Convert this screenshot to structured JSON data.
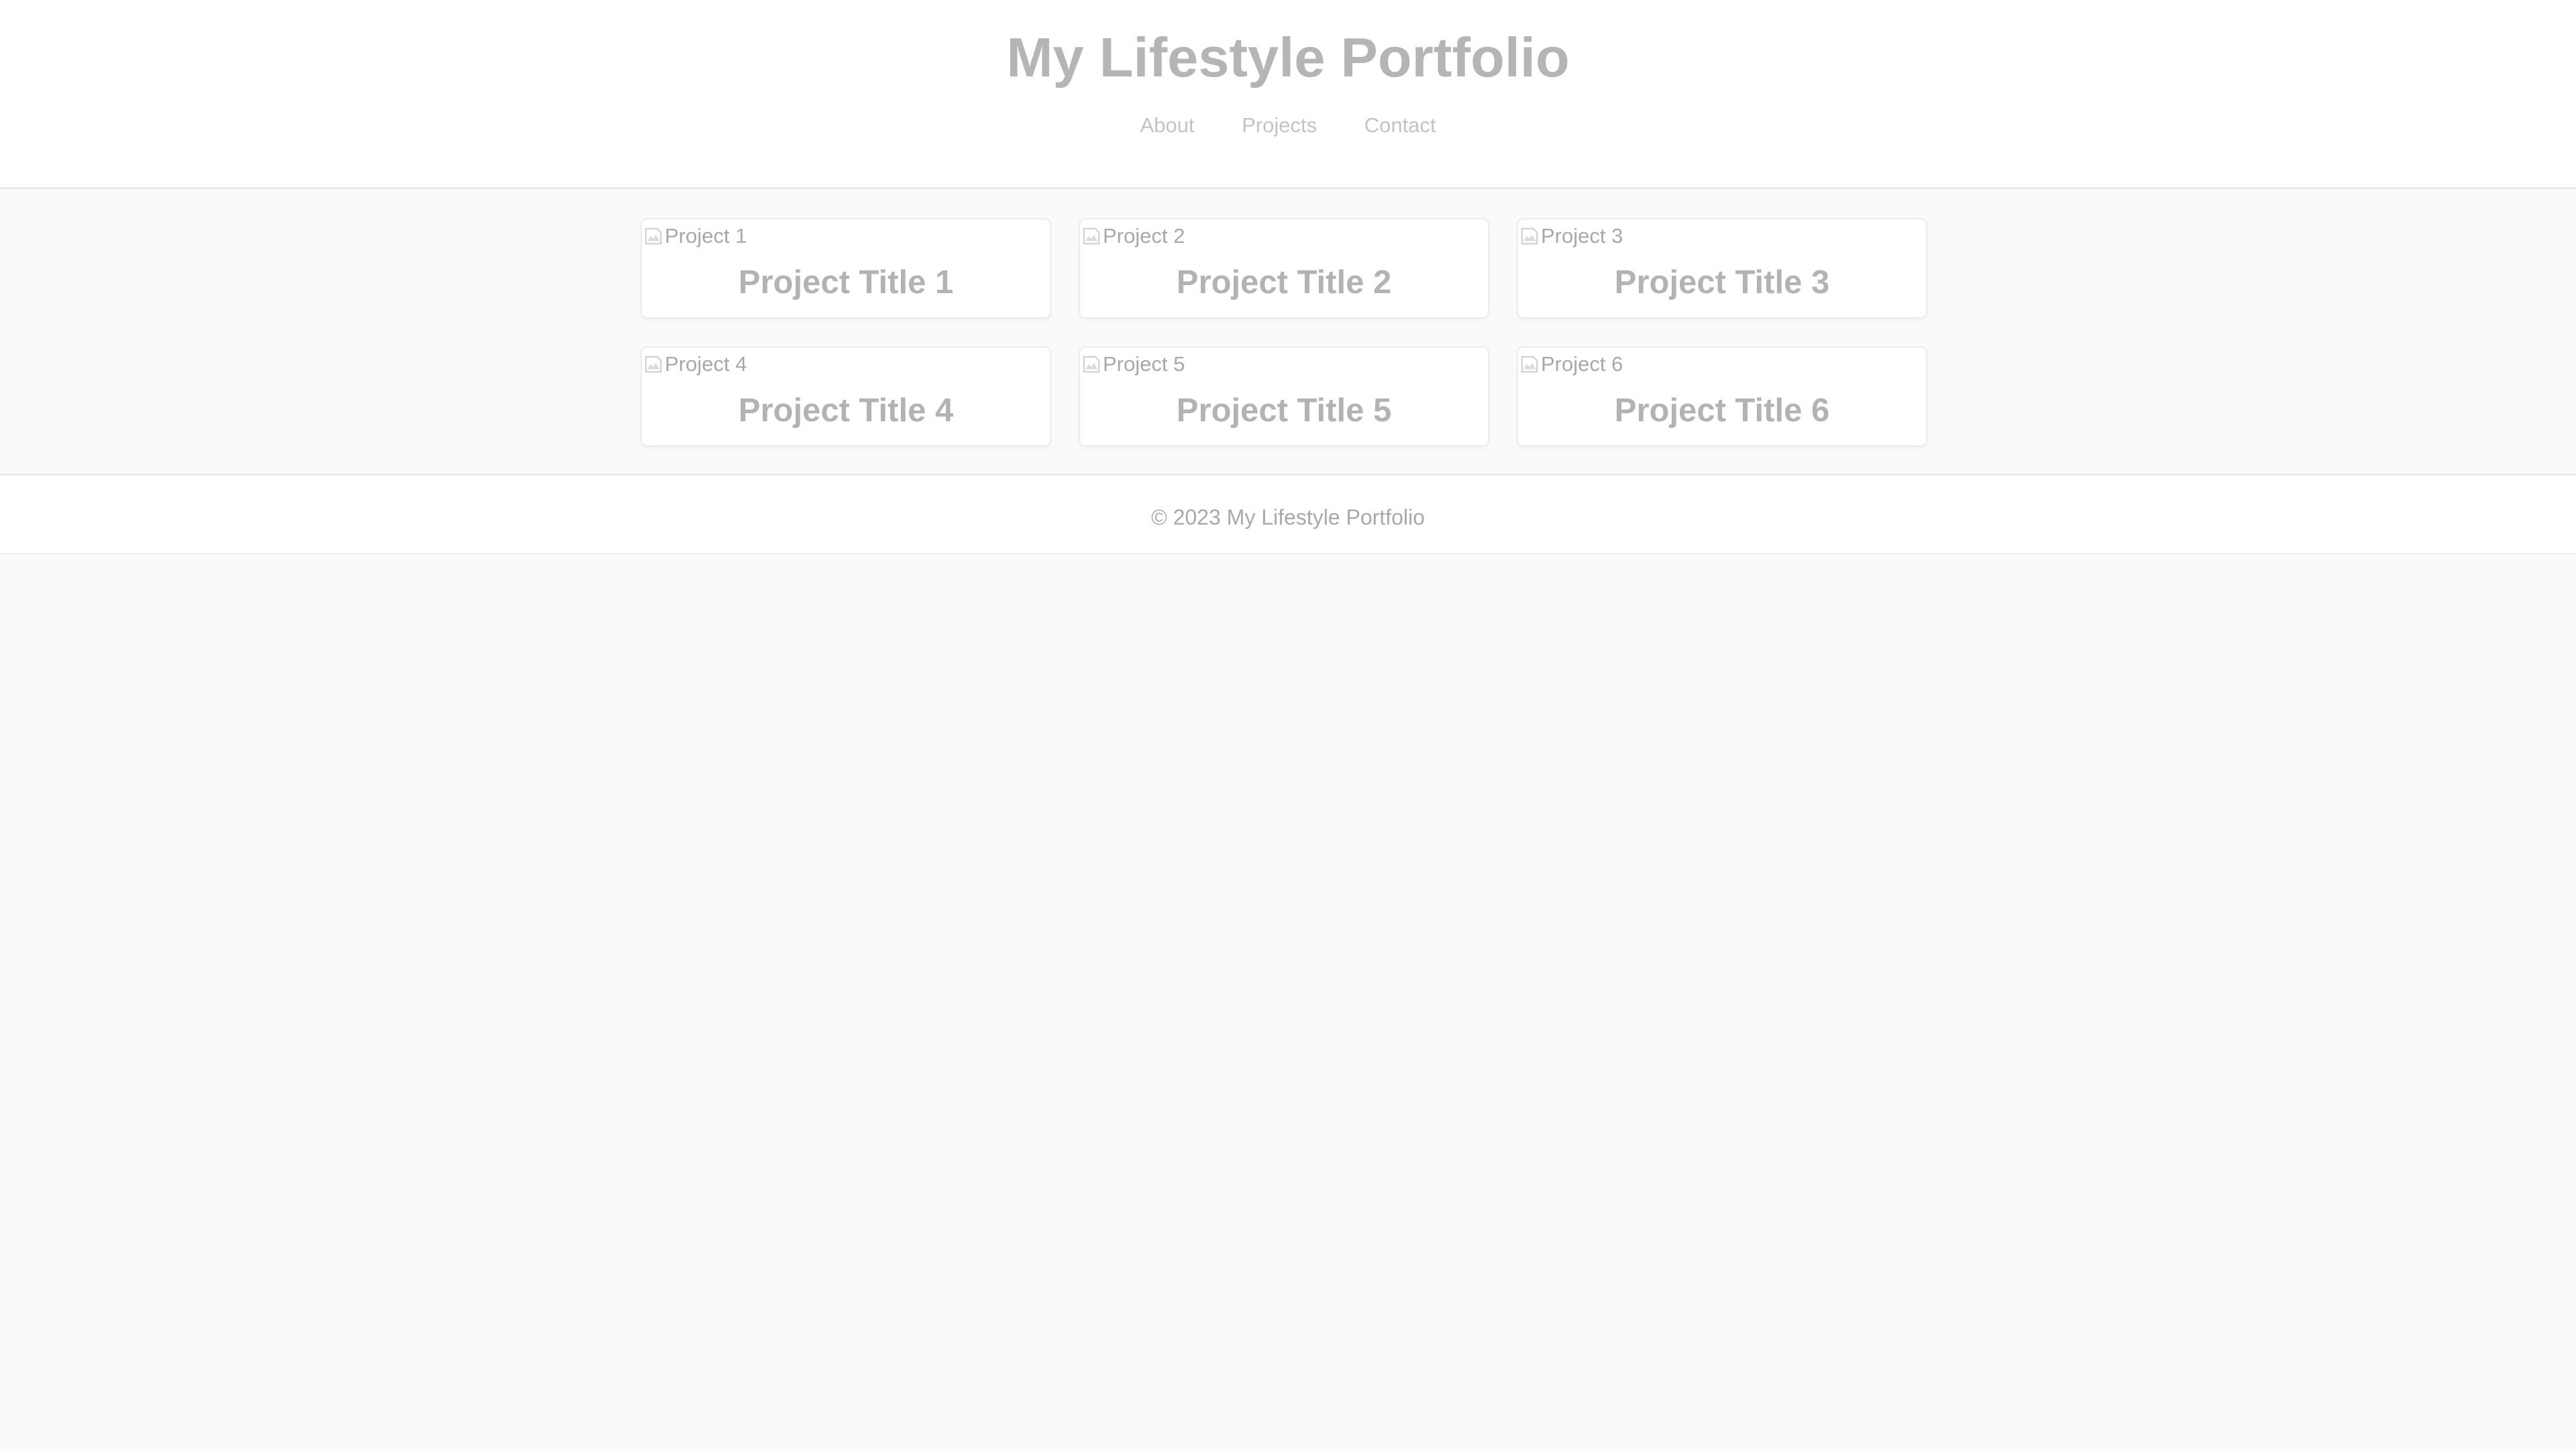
{
  "header": {
    "title": "My Lifestyle Portfolio",
    "nav": [
      "About",
      "Projects",
      "Contact"
    ]
  },
  "projects": [
    {
      "image_alt": "Project 1",
      "title": "Project Title 1"
    },
    {
      "image_alt": "Project 2",
      "title": "Project Title 2"
    },
    {
      "image_alt": "Project 3",
      "title": "Project Title 3"
    },
    {
      "image_alt": "Project 4",
      "title": "Project Title 4"
    },
    {
      "image_alt": "Project 5",
      "title": "Project Title 5"
    },
    {
      "image_alt": "Project 6",
      "title": "Project Title 6"
    }
  ],
  "footer": {
    "text": "© 2023 My Lifestyle Portfolio"
  },
  "icons": {
    "card_image": "broken-image-icon"
  },
  "colors": {
    "page_background": "#fafafa",
    "surface": "#ffffff",
    "title_text": "#b5b5b5",
    "nav_text": "#c3c3c3",
    "muted_text": "#a9a9a9"
  }
}
